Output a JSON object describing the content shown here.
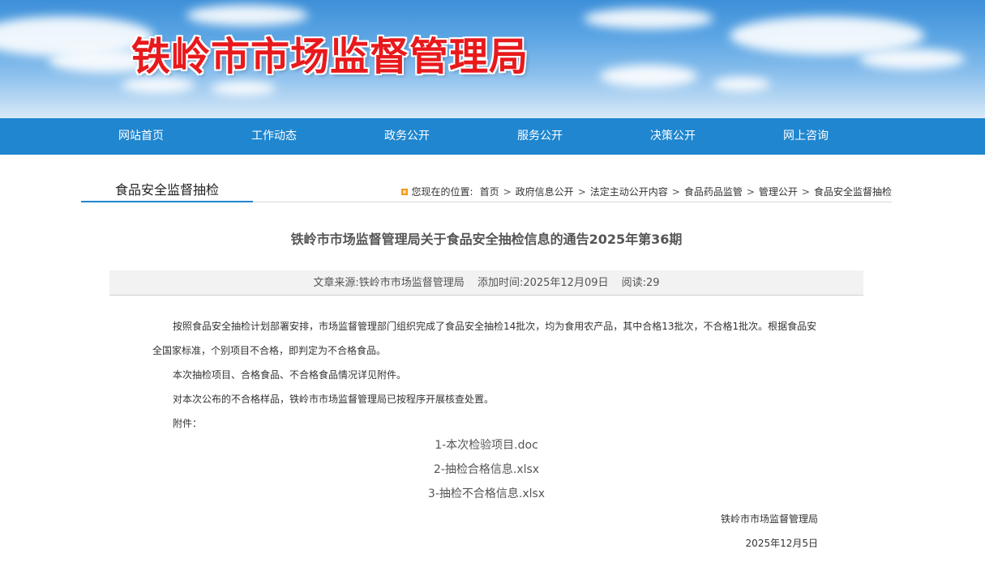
{
  "site": {
    "title": "铁岭市市场监督管理局"
  },
  "nav": {
    "items": [
      {
        "label": "网站首页"
      },
      {
        "label": "工作动态"
      },
      {
        "label": "政务公开"
      },
      {
        "label": "服务公开"
      },
      {
        "label": "决策公开"
      },
      {
        "label": "网上咨询"
      }
    ]
  },
  "section": {
    "title": "食品安全监督抽检"
  },
  "breadcrumb": {
    "prefix": "您现在的位置:",
    "items": [
      "首页",
      "政府信息公开",
      "法定主动公开内容",
      "食品药品监管",
      "管理公开",
      "食品安全监督抽检"
    ],
    "separator": ">"
  },
  "article": {
    "title": "铁岭市市场监督管理局关于食品安全抽检信息的通告2025年第36期",
    "meta": {
      "source": "文章来源:铁岭市市场监督管理局",
      "time": "添加时间:2025年12月09日",
      "reads": "阅读:29"
    },
    "paragraphs": [
      "按照食品安全抽检计划部署安排，市场监督管理部门组织完成了食品安全抽检14批次，均为食用农产品，其中合格13批次，不合格1批次。根据食品安全国家标准，个别项目不合格，即判定为不合格食品。",
      "本次抽检项目、合格食品、不合格食品情况详见附件。",
      "对本次公布的不合格样品，铁岭市市场监督管理局已按程序开展核查处置。",
      "附件："
    ],
    "attachments": [
      "1-本次检验项目.doc",
      "2-抽检合格信息.xlsx",
      "3-抽检不合格信息.xlsx"
    ],
    "signature": "铁岭市市场监督管理局",
    "date": "2025年12月5日"
  },
  "colors": {
    "accent": "#1f86cf",
    "title_red": "#e8191c"
  }
}
